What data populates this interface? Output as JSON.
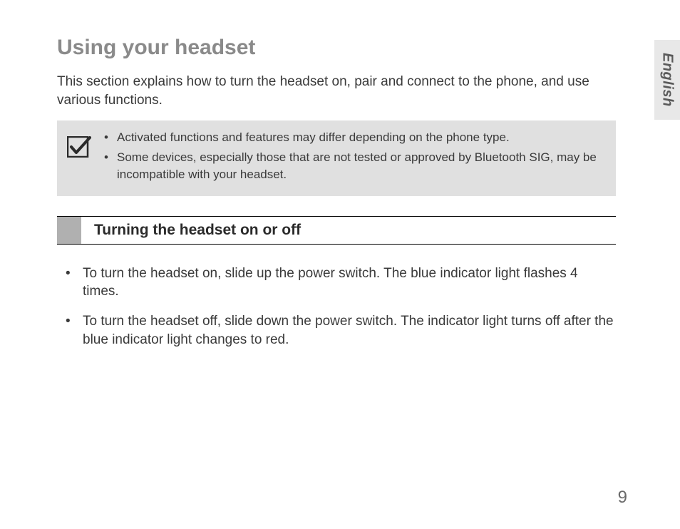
{
  "sidebar": {
    "language": "English"
  },
  "heading": "Using your headset",
  "intro": "This section explains how to turn the headset on, pair and connect to the phone, and use various functions.",
  "note": {
    "items": [
      "Activated functions and features may differ depending on the phone type.",
      "Some devices, especially those that are not tested or approved by Bluetooth SIG, may be incompatible with your headset."
    ]
  },
  "subsection": {
    "title": "Turning the headset on or off",
    "items": [
      "To turn the headset on, slide up the power switch. The blue indicator light flashes 4 times.",
      "To turn the headset off, slide down the power switch. The indicator light turns off after the blue indicator light changes to red."
    ]
  },
  "pageNumber": "9"
}
